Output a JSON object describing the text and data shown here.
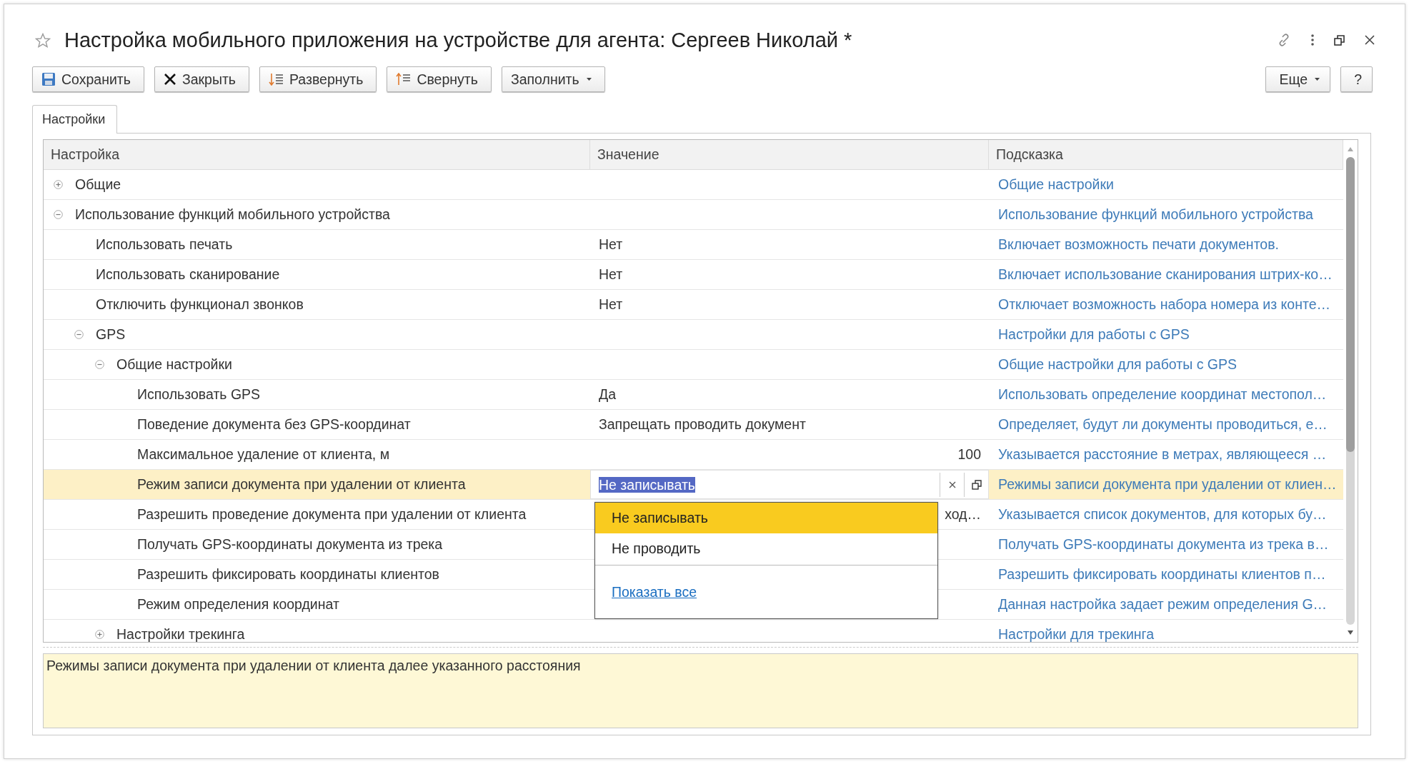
{
  "window": {
    "title": "Настройка мобильного приложения на устройстве для агента: Сергеев Николай *"
  },
  "toolbar": {
    "buttons": [
      {
        "label": "Сохранить",
        "dropdown": false
      },
      {
        "label": "Закрыть",
        "dropdown": false
      },
      {
        "label": "Развернуть",
        "dropdown": false
      },
      {
        "label": "Свернуть",
        "dropdown": false
      },
      {
        "label": "Заполнить",
        "dropdown": true
      }
    ],
    "right_buttons": [
      {
        "label": "Еще",
        "dropdown": true
      },
      {
        "label": "?",
        "dropdown": false
      }
    ]
  },
  "tabs": [
    {
      "label": "Настройки",
      "selected": true
    }
  ],
  "table": {
    "columns": [
      "Настройка",
      "Значение",
      "Подсказка"
    ],
    "rows": [
      {
        "kind": "group",
        "name": "Общие",
        "hint": "Общие настройки",
        "expanded": false,
        "selected": false
      },
      {
        "kind": "group",
        "name": "Использование функций мобильного устройства",
        "hint": "Использование функций мобильного устройства",
        "expanded": true,
        "selected": false,
        "children": [
          {
            "kind": "setting",
            "name": "Использовать печать",
            "value": "Нет",
            "hint": "Включает возможность печати документов.",
            "selected": false
          },
          {
            "kind": "setting",
            "name": "Использовать сканирование",
            "value": "Нет",
            "hint": "Включает использование сканирования штрих-ко…",
            "selected": false
          },
          {
            "kind": "setting",
            "name": "Отключить функционал звонков",
            "value": "Нет",
            "hint": "Отключает возможность набора номера из конте…",
            "selected": false
          },
          {
            "kind": "group",
            "name": "GPS",
            "hint": "Настройки для работы с GPS",
            "expanded": true,
            "selected": false,
            "children": [
              {
                "kind": "group",
                "name": "Общие настройки",
                "hint": "Общие настройки для работы с GPS",
                "expanded": true,
                "selected": false,
                "children": [
                  {
                    "kind": "setting",
                    "name": "Использовать GPS",
                    "value": "Да",
                    "hint": "Использовать определение координат местопол…",
                    "selected": false
                  },
                  {
                    "kind": "setting",
                    "name": "Поведение документа без GPS-координат",
                    "value": "Запрещать проводить документ",
                    "hint": "Определяет, будут ли документы проводиться, е…",
                    "selected": false
                  },
                  {
                    "kind": "number",
                    "name": "Максимальное удаление от клиента, м",
                    "value": "100",
                    "hint": "Указывается расстояние в метрах, являющееся …",
                    "selected": false
                  },
                  {
                    "kind": "setting",
                    "name": "Режим записи документа при удалении от клиента",
                    "value": "Не записывать",
                    "hint": "Режимы записи документа при удалении от клиен…",
                    "selected": true,
                    "dropdown": {
                      "options": [
                        {
                          "label": "Не записывать",
                          "selected": true
                        },
                        {
                          "label": "Не проводить",
                          "selected": false
                        }
                      ],
                      "link": "Показать все"
                    }
                  },
                  {
                    "kind": "setting",
                    "name": "Разрешить проведение документа при удалении от клиента",
                    "value": "ход…",
                    "hint": "Указывается список документов, для которых бу…",
                    "selected": false
                  },
                  {
                    "kind": "setting",
                    "name": "Получать GPS-координаты документа из трека",
                    "hint": "Получать GPS-координаты документа из трека в…",
                    "selected": false
                  },
                  {
                    "kind": "setting",
                    "name": "Разрешить фиксировать координаты клиентов",
                    "hint": "Разрешить фиксировать координаты клиентов п…",
                    "selected": false
                  },
                  {
                    "kind": "setting",
                    "name": "Режим определения координат",
                    "hint": "Данная настройка задает режим определения G…",
                    "selected": false
                  }
                ]
              },
              {
                "kind": "group",
                "name": "Настройки трекинга",
                "hint": "Настройки для трекинга",
                "expanded": false,
                "selected": false
              }
            ]
          }
        ]
      }
    ]
  },
  "description": "Режимы записи документа при удалении от клиента далее указанного расстояния"
}
